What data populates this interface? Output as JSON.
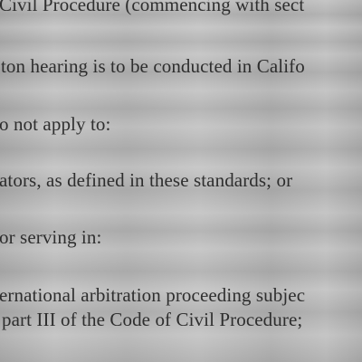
{
  "document": {
    "lines": [
      "Civil Procedure (commencing with sect",
      "ton hearing is to be conducted in Califo",
      "o not apply to:",
      "ators, as defined in these standards; or",
      "or serving in:",
      "ernational arbitration proceeding subjec",
      "part III of the Code of Civil Procedure;"
    ]
  }
}
